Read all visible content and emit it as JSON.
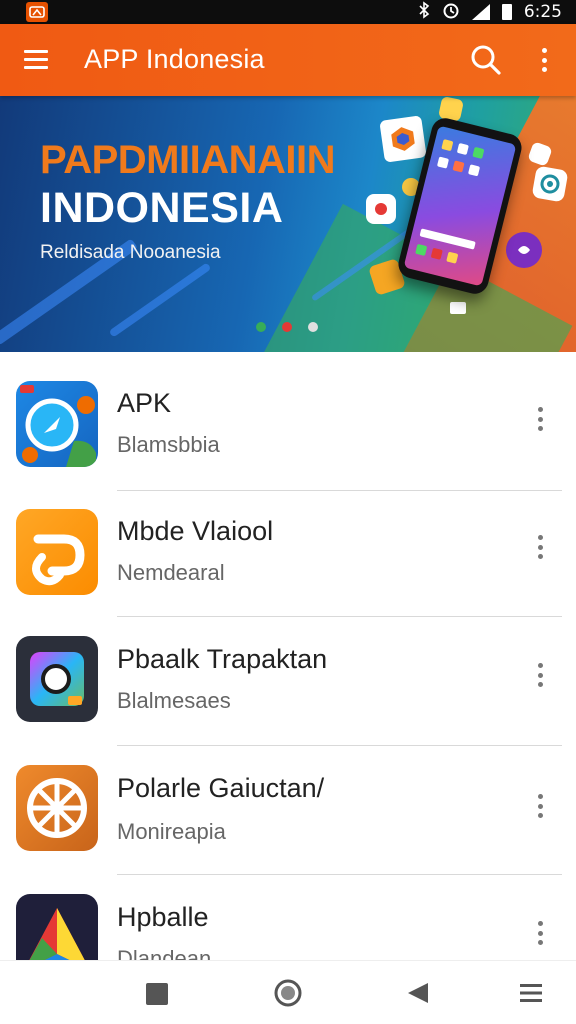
{
  "status_bar": {
    "time": "6:25",
    "icons": [
      "app-notification-icon",
      "bluetooth-icon",
      "alarm-icon",
      "signal-icon",
      "battery-icon"
    ]
  },
  "toolbar": {
    "title": "APP Indonesia",
    "icons": [
      "menu-icon",
      "search-icon",
      "more-vert-icon"
    ],
    "color": "#f05a13"
  },
  "banner": {
    "headline": "PAPDMIIANAIIN",
    "title": "INDONESIA",
    "subtitle": "Reldisada Nooanesia",
    "carousel_dots": [
      "#37ad59",
      "#e53935",
      "#e0e0e0"
    ]
  },
  "apps": [
    {
      "name": "APK",
      "subtitle": "Blamsbbia",
      "icon": "blue-compass-app-icon"
    },
    {
      "name": "Mbde Vlaiool",
      "subtitle": "Nemdearal",
      "icon": "orange-p-app-icon"
    },
    {
      "name": "Pbaalk Trapaktan",
      "subtitle": "Blalmesaes",
      "icon": "dark-camera-app-icon"
    },
    {
      "name": "Polarle Gaiuctan/",
      "subtitle": "Monireapia",
      "icon": "orange-wheel-app-icon"
    },
    {
      "name": "Hpballe",
      "subtitle": "Dlandean",
      "icon": "triangle-app-icon"
    }
  ],
  "nav_bar": {
    "icons": [
      "recents-square-icon",
      "home-circle-icon",
      "back-triangle-icon",
      "menu-lines-icon"
    ]
  }
}
